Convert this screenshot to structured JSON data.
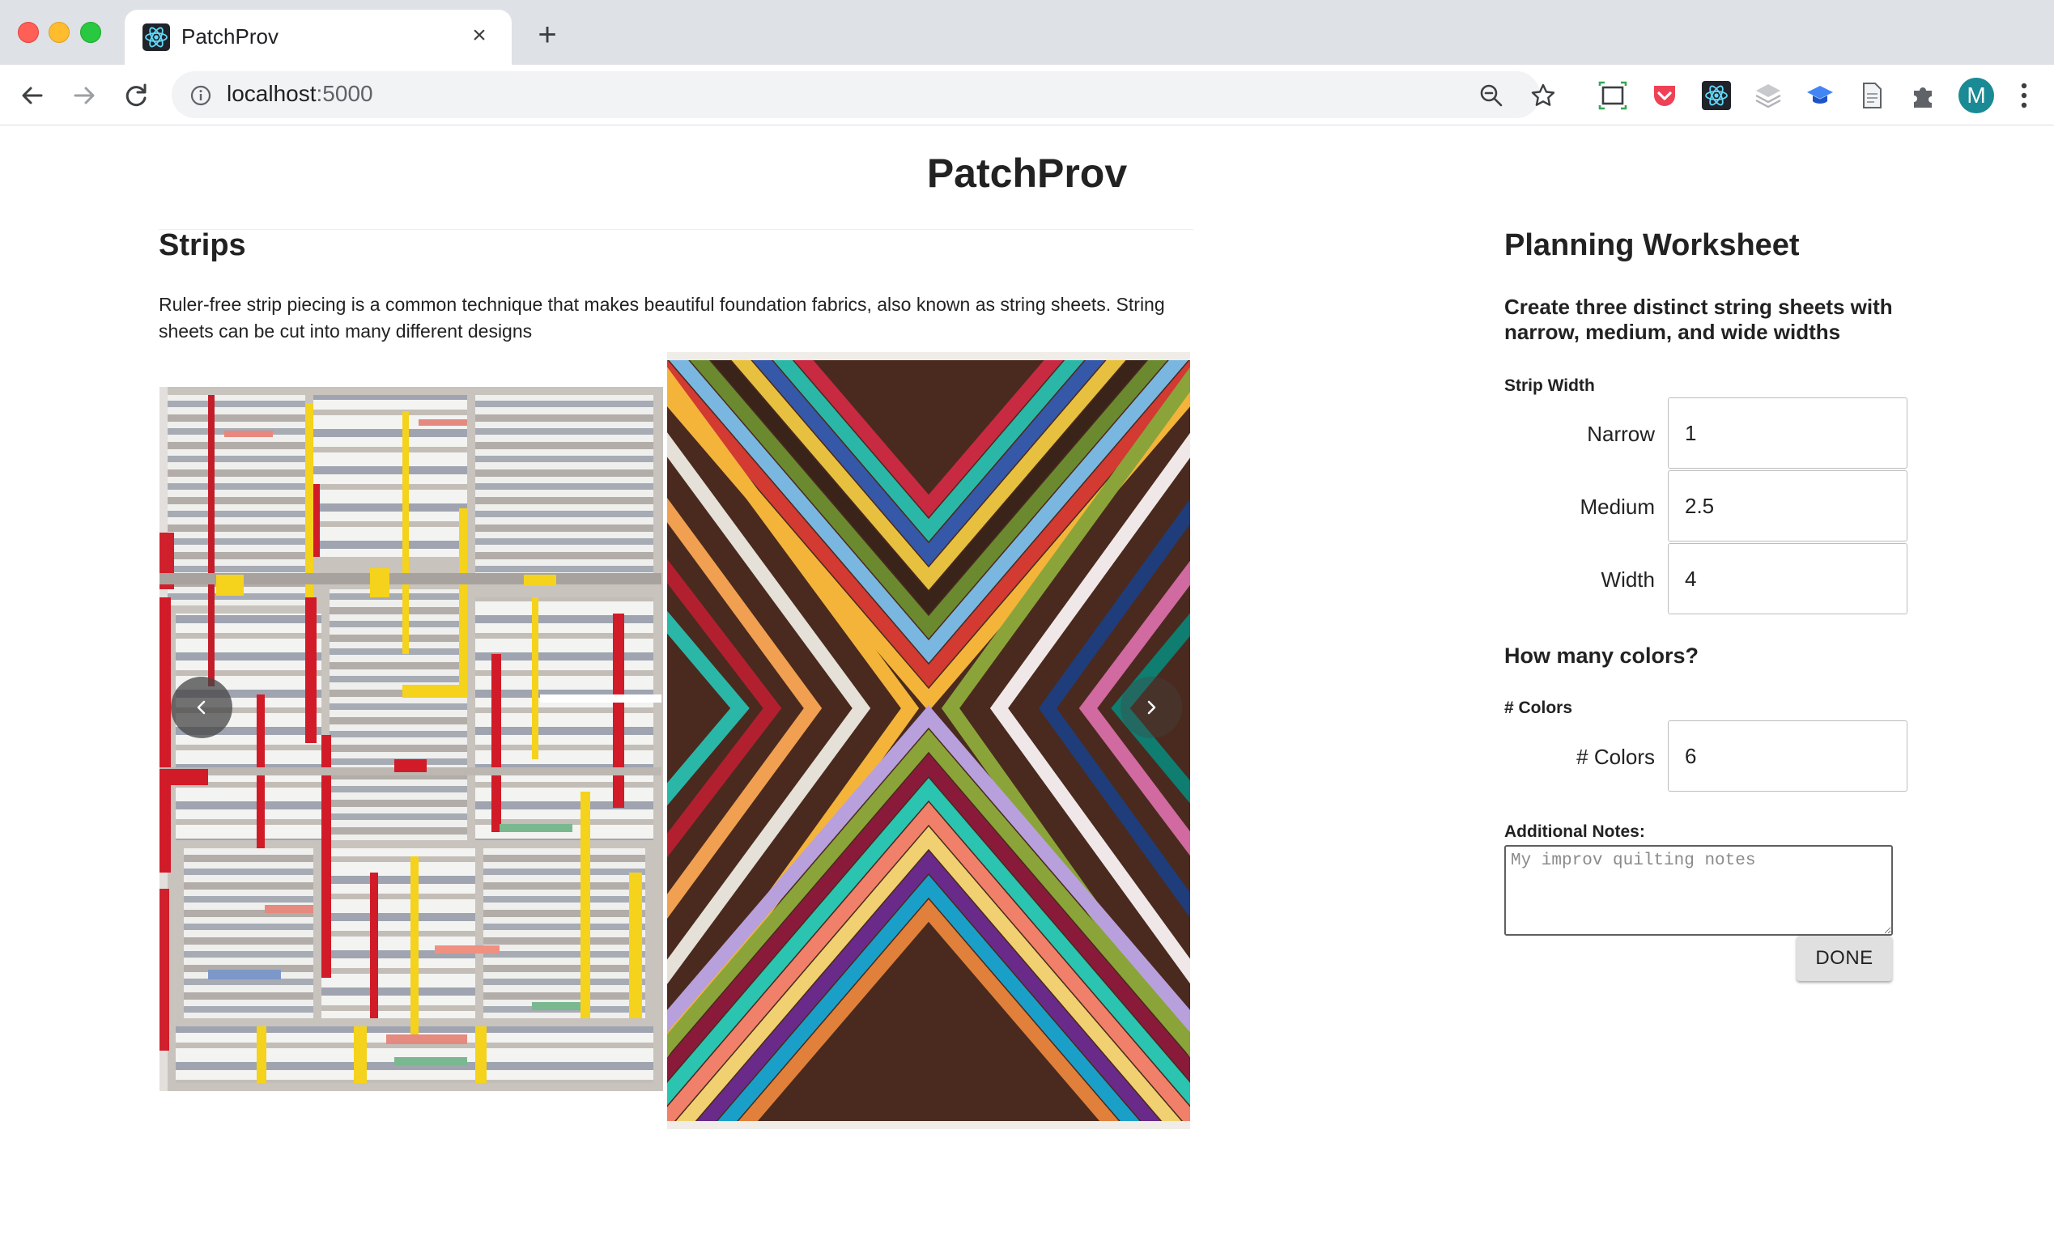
{
  "browser": {
    "tab_title": "PatchProv",
    "tab_close": "×",
    "new_tab": "+",
    "url_host": "localhost",
    "url_port": ":5000",
    "avatar_initial": "M",
    "extension_icons": [
      "screen-capture-icon",
      "pocket-icon",
      "react-devtools-icon",
      "layers-icon",
      "graduation-cap-icon",
      "document-icon",
      "puzzle-icon"
    ]
  },
  "page": {
    "app_title": "PatchProv",
    "section_title": "Strips",
    "description": "Ruler-free strip piecing is a common technique that makes beautiful foundation fabrics, also known as string sheets. String sheets can be cut into many different designs"
  },
  "worksheet": {
    "title": "Planning Worksheet",
    "subtitle": "Create three distinct string sheets with narrow, medium, and wide widths",
    "strip_width_label": "Strip Width",
    "narrow_label": "Narrow",
    "narrow_value": "1",
    "medium_label": "Medium",
    "medium_value": "2.5",
    "width_label": "Width",
    "width_value": "4",
    "colors_heading": "How many colors?",
    "colors_section_label": "# Colors",
    "colors_label": "# Colors",
    "colors_value": "6",
    "notes_label": "Additional Notes:",
    "notes_placeholder": "My improv quilting notes",
    "done_label": "DONE"
  },
  "colors": {
    "accent_teal": "#1a8a95",
    "tabbar": "#dee1e6",
    "omnibox": "#f1f3f4"
  }
}
